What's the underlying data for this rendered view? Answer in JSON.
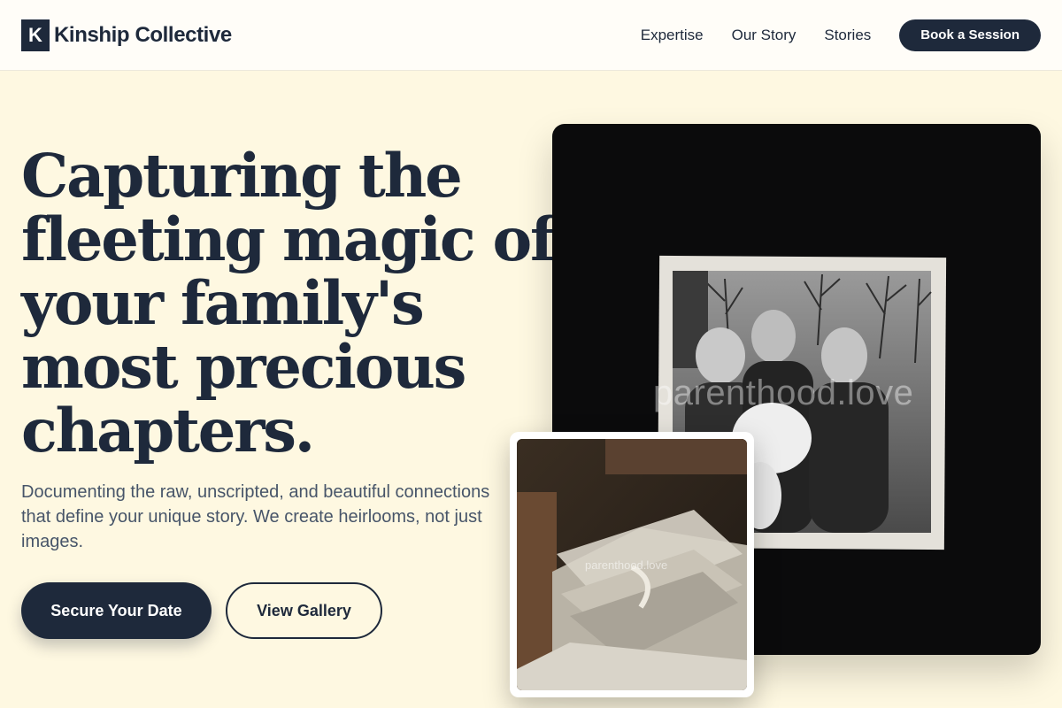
{
  "header": {
    "logo_letter": "K",
    "brand": "Kinship Collective",
    "nav": [
      "Expertise",
      "Our Story",
      "Stories"
    ],
    "cta": "Book a Session"
  },
  "hero": {
    "headline_lines": [
      "Capturing the",
      "fleeting magic of",
      "your family's",
      "most precious",
      "chapters."
    ],
    "subtext": "Documenting the raw, unscripted, and beautiful connections that define your unique story. We create heirlooms, not just images.",
    "primary_button": "Secure Your Date",
    "secondary_button": "View Gallery"
  },
  "images": {
    "main_watermark": "parenthood.love",
    "inset_watermark": "parenthood.love",
    "main_icon": "vintage-family-photo",
    "inset_icon": "acrylic-keepsake-box"
  },
  "colors": {
    "background": "#fef8e1",
    "primary": "#1e293b",
    "text_muted": "#475569"
  }
}
